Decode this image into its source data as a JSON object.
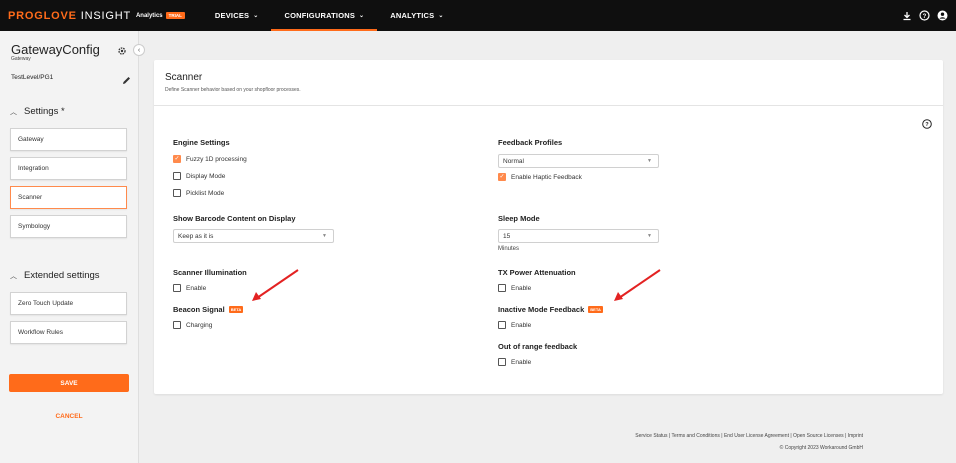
{
  "brand": {
    "pro": "PROGLOVE",
    "insight": "INSIGHT",
    "analytics": "Analytics",
    "trial": "TRIAL"
  },
  "nav": [
    {
      "label": "DEVICES"
    },
    {
      "label": "CONFIGURATIONS"
    },
    {
      "label": "ANALYTICS"
    }
  ],
  "sidebar": {
    "title": "GatewayConfig",
    "subtitle": "Gateway",
    "path": "TestLevel/PG1",
    "settings_header": "Settings *",
    "settings_items": [
      {
        "label": "Gateway"
      },
      {
        "label": "Integration"
      },
      {
        "label": "Scanner"
      },
      {
        "label": "Symbology"
      }
    ],
    "extended_header": "Extended settings",
    "extended_items": [
      {
        "label": "Zero Touch Update"
      },
      {
        "label": "Workflow Rules"
      }
    ],
    "save_label": "SAVE",
    "cancel_label": "CANCEL"
  },
  "card": {
    "title": "Scanner",
    "description": "Define Scanner behavior based on your shopfloor processes.",
    "engine_settings": {
      "title": "Engine Settings",
      "options": [
        {
          "label": "Fuzzy 1D processing",
          "checked": true
        },
        {
          "label": "Display Mode",
          "checked": false
        },
        {
          "label": "Picklist Mode",
          "checked": false
        }
      ]
    },
    "feedback_profiles": {
      "title": "Feedback Profiles",
      "selected": "Normal",
      "haptic_label": "Enable Haptic Feedback",
      "haptic_checked": true
    },
    "barcode_display": {
      "title": "Show Barcode Content on Display",
      "selected": "Keep as it is"
    },
    "sleep_mode": {
      "title": "Sleep Mode",
      "selected": "15",
      "unit": "Minutes"
    },
    "illumination": {
      "title": "Scanner Illumination",
      "label": "Enable",
      "checked": false
    },
    "tx_power": {
      "title": "TX Power Attenuation",
      "label": "Enable",
      "checked": false
    },
    "beacon": {
      "title": "Beacon Signal",
      "badge": "BETA",
      "label": "Charging",
      "checked": false
    },
    "inactive_mode": {
      "title": "Inactive Mode Feedback",
      "badge": "BETA",
      "label": "Enable",
      "checked": false
    },
    "out_of_range": {
      "title": "Out of range feedback",
      "label": "Enable",
      "checked": false
    }
  },
  "footer": {
    "links": "Service Status | Terms and Conditions | End User License Agreement | Open Source Licenses | Imprint",
    "copyright": "© Copyright 2023 Workaround GmbH"
  },
  "colors": {
    "accent": "#ff6b1a",
    "topbar": "#0f0f0f",
    "annotation_arrow": "#e32222"
  }
}
